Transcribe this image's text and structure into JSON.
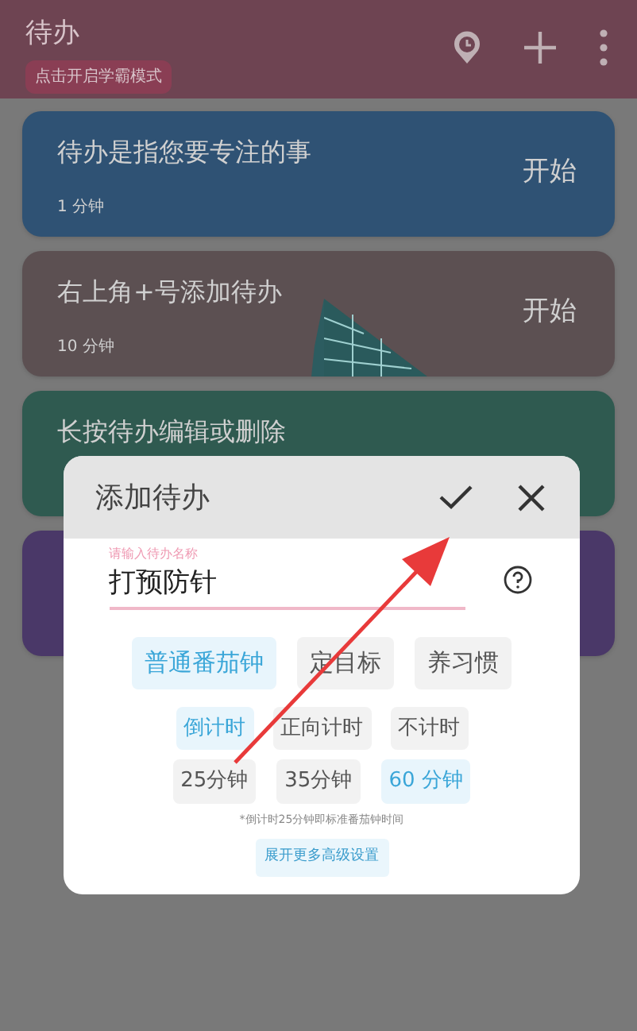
{
  "header": {
    "title": "待办",
    "study_mode_button": "点击开启学霸模式"
  },
  "tasks": [
    {
      "title": "待办是指您要专注的事",
      "duration": "1 分钟",
      "start": "开始",
      "color": "#2f5274"
    },
    {
      "title": "右上角+号添加待办",
      "duration": "10 分钟",
      "start": "开始",
      "color": "#5c5052"
    },
    {
      "title": "长按待办编辑或删除",
      "color": "#2f5a50"
    },
    {
      "color": "#4a3868"
    }
  ],
  "dialog": {
    "title": "添加待办",
    "name_field": {
      "label": "请输入待办名称",
      "value": "打预防针"
    },
    "mode_options": [
      {
        "label": "普通番茄钟",
        "selected": true
      },
      {
        "label": "定目标",
        "selected": false
      },
      {
        "label": "养习惯",
        "selected": false
      }
    ],
    "timer_options": [
      {
        "label": "倒计时",
        "selected": true
      },
      {
        "label": "正向计时",
        "selected": false
      },
      {
        "label": "不计时",
        "selected": false
      }
    ],
    "duration_options": [
      {
        "label": "25分钟",
        "selected": false
      },
      {
        "label": "35分钟",
        "selected": false
      },
      {
        "label": "60 分钟",
        "selected": true
      }
    ],
    "note": "*倒计时25分钟即标准番茄钟时间",
    "advanced_button": "展开更多高级设置"
  }
}
